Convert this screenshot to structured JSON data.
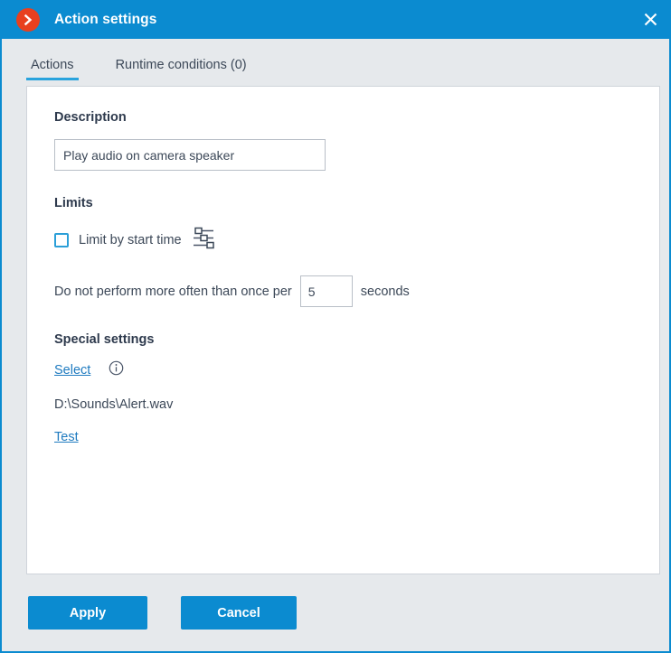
{
  "window": {
    "title": "Action settings",
    "app_icon": "chevron-right-circle-icon",
    "close_icon": "close-icon",
    "accent_color": "#0b8bd0",
    "app_icon_color": "#e8401f"
  },
  "tabs": [
    {
      "label": "Actions",
      "active": true
    },
    {
      "label": "Runtime conditions (0)",
      "active": false
    }
  ],
  "form": {
    "description": {
      "heading": "Description",
      "value": "Play audio on camera speaker",
      "placeholder": ""
    },
    "limits": {
      "heading": "Limits",
      "limit_by_start_time": {
        "label": "Limit by start time",
        "checked": false,
        "settings_icon": "sliders-icon"
      },
      "throttle": {
        "prefix": "Do not perform more often than once per",
        "value": "5",
        "suffix": "seconds"
      }
    },
    "special_settings": {
      "heading": "Special settings",
      "select_link": "Select",
      "info_icon": "info-circle-icon",
      "file_path": "D:\\Sounds\\Alert.wav",
      "test_link": "Test"
    }
  },
  "footer": {
    "apply_label": "Apply",
    "cancel_label": "Cancel"
  }
}
